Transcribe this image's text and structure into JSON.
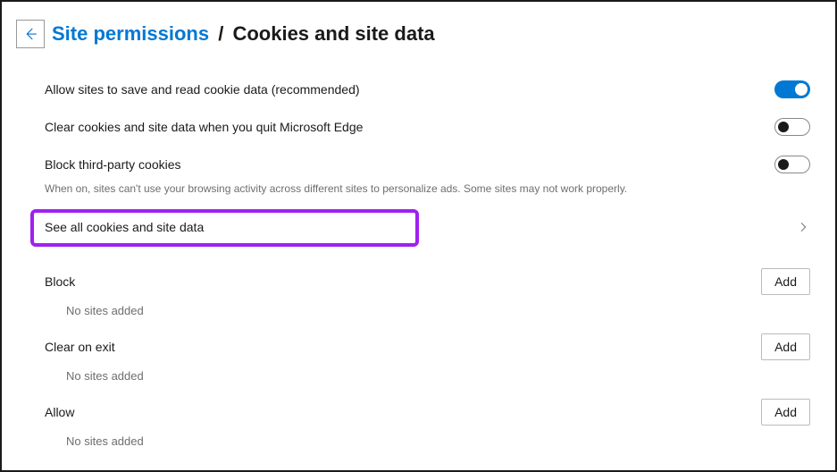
{
  "header": {
    "breadcrumb_link": "Site permissions",
    "breadcrumb_sep": "/",
    "breadcrumb_current": "Cookies and site data"
  },
  "settings": {
    "allow_cookies": {
      "label": "Allow sites to save and read cookie data (recommended)",
      "enabled": true
    },
    "clear_on_quit": {
      "label": "Clear cookies and site data when you quit Microsoft Edge",
      "enabled": false
    },
    "block_third_party": {
      "label": "Block third-party cookies",
      "description": "When on, sites can't use your browsing activity across different sites to personalize ads. Some sites may not work properly.",
      "enabled": false
    },
    "see_all": {
      "label": "See all cookies and site data"
    }
  },
  "sections": {
    "block": {
      "title": "Block",
      "add_label": "Add",
      "empty": "No sites added"
    },
    "clear_on_exit": {
      "title": "Clear on exit",
      "add_label": "Add",
      "empty": "No sites added"
    },
    "allow": {
      "title": "Allow",
      "add_label": "Add",
      "empty": "No sites added"
    }
  }
}
